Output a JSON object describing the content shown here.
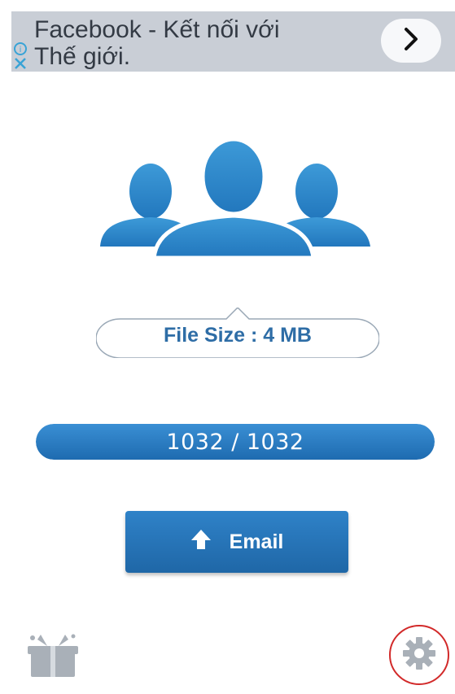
{
  "ad": {
    "title_line1": "Facebook - Kết nối với",
    "title_line2": "Thế giới.",
    "arrow_icon": "chevron-right-icon",
    "choices_icon": "ad-choices-icon"
  },
  "illustration": {
    "icon": "contacts-group-icon"
  },
  "file_size": {
    "label": "File Size : 4 MB"
  },
  "progress": {
    "text": "1032 / 1032",
    "fraction": 1.0
  },
  "email_button": {
    "label": "Email",
    "icon": "upload-arrow-icon"
  },
  "bottom": {
    "left_icon": "gift-box-icon",
    "right_icon": "gear-icon"
  },
  "colors": {
    "accent": "#2a7bc0",
    "ad_bg": "#c9ced6",
    "highlight_ring": "#d22a2a"
  }
}
